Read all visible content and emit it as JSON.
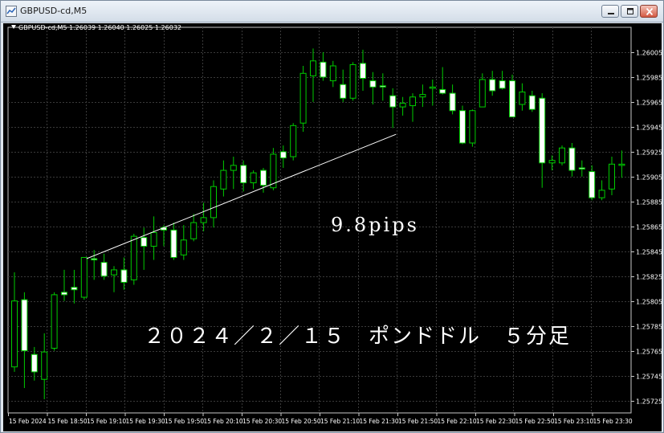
{
  "window": {
    "title": "GBPUSD-cd,M5",
    "controls": [
      "minimize",
      "maximize",
      "close"
    ]
  },
  "chart": {
    "info_label": "GBPUSD-cd,M5  1.26039 1.26040 1.26025 1.26032",
    "annotations": {
      "pips": "9.8pips",
      "title": "２０２４／２／１５　ポンドドル　５分足"
    },
    "colors": {
      "background": "#000000",
      "grid": "#3a3a3a",
      "bull_candle": "#000000",
      "bear_candle": "#ffffff",
      "wick": "#00cc00",
      "trendline": "#ffffff",
      "axis_text": "#ffffff"
    }
  },
  "chart_data": {
    "type": "candlestick",
    "symbol": "GBPUSD-cd",
    "timeframe": "M5",
    "ylim": [
      1.25715,
      1.26025
    ],
    "y_ticks": [
      "1.26005",
      "1.25985",
      "1.25965",
      "1.25945",
      "1.25925",
      "1.25905",
      "1.25885",
      "1.25865",
      "1.25845",
      "1.25825",
      "1.25805",
      "1.25785",
      "1.25765",
      "1.25745",
      "1.25725"
    ],
    "x_ticks": [
      "15 Feb 2024",
      "15 Feb 18:50",
      "15 Feb 19:10",
      "15 Feb 19:30",
      "15 Feb 19:50",
      "15 Feb 20:10",
      "15 Feb 20:30",
      "15 Feb 20:50",
      "15 Feb 21:10",
      "15 Feb 21:30",
      "15 Feb 21:50",
      "15 Feb 22:10",
      "15 Feb 22:30",
      "15 Feb 22:50",
      "15 Feb 23:10",
      "15 Feb 23:30"
    ],
    "candles": [
      {
        "o": 1.25752,
        "h": 1.25828,
        "l": 1.25748,
        "c": 1.25805
      },
      {
        "o": 1.25806,
        "h": 1.25812,
        "l": 1.25735,
        "c": 1.25765
      },
      {
        "o": 1.25762,
        "h": 1.25768,
        "l": 1.25741,
        "c": 1.25748
      },
      {
        "o": 1.25742,
        "h": 1.25779,
        "l": 1.25726,
        "c": 1.25764
      },
      {
        "o": 1.25767,
        "h": 1.25812,
        "l": 1.25765,
        "c": 1.2581
      },
      {
        "o": 1.25812,
        "h": 1.2583,
        "l": 1.25805,
        "c": 1.2581
      },
      {
        "o": 1.25816,
        "h": 1.2583,
        "l": 1.25803,
        "c": 1.25814
      },
      {
        "o": 1.25808,
        "h": 1.2584,
        "l": 1.25806,
        "c": 1.2584
      },
      {
        "o": 1.25839,
        "h": 1.25846,
        "l": 1.25822,
        "c": 1.25838
      },
      {
        "o": 1.25836,
        "h": 1.25843,
        "l": 1.25822,
        "c": 1.25825
      },
      {
        "o": 1.25826,
        "h": 1.25833,
        "l": 1.25812,
        "c": 1.2583
      },
      {
        "o": 1.2583,
        "h": 1.2584,
        "l": 1.25814,
        "c": 1.2582
      },
      {
        "o": 1.25822,
        "h": 1.25859,
        "l": 1.25818,
        "c": 1.25857
      },
      {
        "o": 1.25856,
        "h": 1.25864,
        "l": 1.2583,
        "c": 1.25849
      },
      {
        "o": 1.25849,
        "h": 1.25873,
        "l": 1.25838,
        "c": 1.2586
      },
      {
        "o": 1.25864,
        "h": 1.25866,
        "l": 1.25849,
        "c": 1.25862
      },
      {
        "o": 1.25862,
        "h": 1.25868,
        "l": 1.25838,
        "c": 1.2584
      },
      {
        "o": 1.25842,
        "h": 1.25866,
        "l": 1.25838,
        "c": 1.25854
      },
      {
        "o": 1.25855,
        "h": 1.25875,
        "l": 1.25853,
        "c": 1.25868
      },
      {
        "o": 1.25868,
        "h": 1.25884,
        "l": 1.25861,
        "c": 1.25872
      },
      {
        "o": 1.25872,
        "h": 1.25902,
        "l": 1.25864,
        "c": 1.25897
      },
      {
        "o": 1.25895,
        "h": 1.25918,
        "l": 1.25889,
        "c": 1.2591
      },
      {
        "o": 1.2591,
        "h": 1.25921,
        "l": 1.25895,
        "c": 1.25914
      },
      {
        "o": 1.25914,
        "h": 1.25918,
        "l": 1.25893,
        "c": 1.259
      },
      {
        "o": 1.259,
        "h": 1.2591,
        "l": 1.25895,
        "c": 1.25908
      },
      {
        "o": 1.2591,
        "h": 1.25912,
        "l": 1.25892,
        "c": 1.25898
      },
      {
        "o": 1.25896,
        "h": 1.25928,
        "l": 1.25894,
        "c": 1.25923
      },
      {
        "o": 1.25925,
        "h": 1.2593,
        "l": 1.25912,
        "c": 1.2592
      },
      {
        "o": 1.25921,
        "h": 1.25948,
        "l": 1.25918,
        "c": 1.25946
      },
      {
        "o": 1.25948,
        "h": 1.25994,
        "l": 1.25941,
        "c": 1.25988
      },
      {
        "o": 1.25986,
        "h": 1.26008,
        "l": 1.25965,
        "c": 1.25998
      },
      {
        "o": 1.25997,
        "h": 1.26005,
        "l": 1.25982,
        "c": 1.25985
      },
      {
        "o": 1.25982,
        "h": 1.25998,
        "l": 1.25977,
        "c": 1.25994
      },
      {
        "o": 1.25979,
        "h": 1.25991,
        "l": 1.25965,
        "c": 1.25968
      },
      {
        "o": 1.25968,
        "h": 1.25997,
        "l": 1.25966,
        "c": 1.25995
      },
      {
        "o": 1.25996,
        "h": 1.26007,
        "l": 1.25974,
        "c": 1.25984
      },
      {
        "o": 1.25982,
        "h": 1.25989,
        "l": 1.25963,
        "c": 1.25977
      },
      {
        "o": 1.25978,
        "h": 1.25988,
        "l": 1.25966,
        "c": 1.25977
      },
      {
        "o": 1.2597,
        "h": 1.25976,
        "l": 1.25944,
        "c": 1.25961
      },
      {
        "o": 1.25961,
        "h": 1.25969,
        "l": 1.25954,
        "c": 1.25964
      },
      {
        "o": 1.25962,
        "h": 1.25972,
        "l": 1.25949,
        "c": 1.25969
      },
      {
        "o": 1.25969,
        "h": 1.25979,
        "l": 1.25961,
        "c": 1.25971
      },
      {
        "o": 1.25976,
        "h": 1.25983,
        "l": 1.25962,
        "c": 1.25977
      },
      {
        "o": 1.25975,
        "h": 1.25993,
        "l": 1.25971,
        "c": 1.25972
      },
      {
        "o": 1.25972,
        "h": 1.25979,
        "l": 1.25955,
        "c": 1.25958
      },
      {
        "o": 1.25958,
        "h": 1.25962,
        "l": 1.25931,
        "c": 1.25932
      },
      {
        "o": 1.25932,
        "h": 1.25959,
        "l": 1.25929,
        "c": 1.25958
      },
      {
        "o": 1.25961,
        "h": 1.25988,
        "l": 1.25961,
        "c": 1.25983
      },
      {
        "o": 1.25983,
        "h": 1.2599,
        "l": 1.2597,
        "c": 1.25974
      },
      {
        "o": 1.25982,
        "h": 1.2599,
        "l": 1.25975,
        "c": 1.25976
      },
      {
        "o": 1.25982,
        "h": 1.25987,
        "l": 1.25953,
        "c": 1.25953
      },
      {
        "o": 1.25963,
        "h": 1.2598,
        "l": 1.25958,
        "c": 1.25973
      },
      {
        "o": 1.2597,
        "h": 1.25974,
        "l": 1.25957,
        "c": 1.25959
      },
      {
        "o": 1.25968,
        "h": 1.25972,
        "l": 1.25896,
        "c": 1.25916
      },
      {
        "o": 1.25916,
        "h": 1.25922,
        "l": 1.2591,
        "c": 1.25918
      },
      {
        "o": 1.25916,
        "h": 1.2593,
        "l": 1.25914,
        "c": 1.25928
      },
      {
        "o": 1.25928,
        "h": 1.25932,
        "l": 1.25905,
        "c": 1.2591
      },
      {
        "o": 1.25912,
        "h": 1.25918,
        "l": 1.25905,
        "c": 1.25911
      },
      {
        "o": 1.25909,
        "h": 1.25914,
        "l": 1.25886,
        "c": 1.25888
      },
      {
        "o": 1.25888,
        "h": 1.25902,
        "l": 1.25886,
        "c": 1.25894
      },
      {
        "o": 1.25895,
        "h": 1.25921,
        "l": 1.2589,
        "c": 1.25915
      },
      {
        "o": 1.25914,
        "h": 1.25926,
        "l": 1.25904,
        "c": 1.25915
      }
    ],
    "trendline": {
      "from": {
        "candle": 7,
        "price": 1.25839
      },
      "to": {
        "candle": 38,
        "price": 1.25939
      }
    }
  }
}
